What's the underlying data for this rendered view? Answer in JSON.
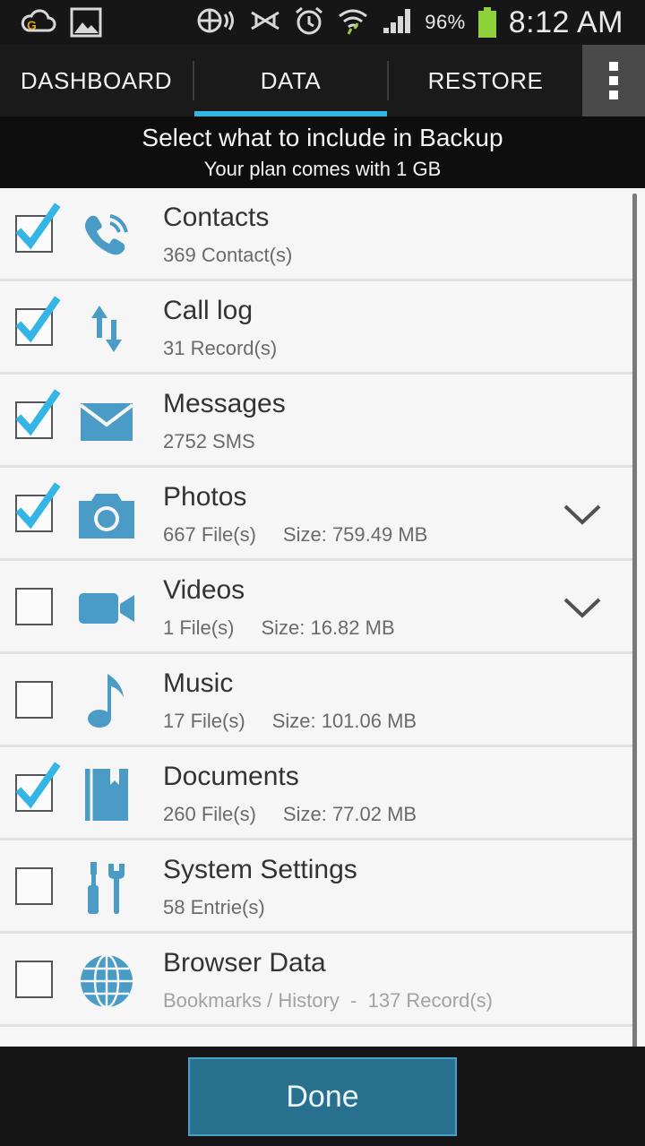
{
  "status_bar": {
    "battery_percent": "96%",
    "time": "8:12 AM",
    "icons": [
      "cloud-icon",
      "image-icon",
      "nfc-icon",
      "vibrate-icon",
      "alarm-icon",
      "wifi-icon",
      "signal-icon",
      "battery-icon"
    ]
  },
  "tabs": [
    {
      "label": "DASHBOARD",
      "selected": false
    },
    {
      "label": "DATA",
      "selected": true
    },
    {
      "label": "RESTORE",
      "selected": false
    }
  ],
  "header": {
    "title": "Select what to include in Backup",
    "subtitle": "Your plan comes with 1 GB"
  },
  "items": [
    {
      "title": "Contacts",
      "count": "369 Contact(s)",
      "size": "",
      "checked": true,
      "icon": "phone-icon",
      "expandable": false
    },
    {
      "title": "Call log",
      "count": "31 Record(s)",
      "size": "",
      "checked": true,
      "icon": "arrows-updown-icon",
      "expandable": false
    },
    {
      "title": "Messages",
      "count": "2752 SMS",
      "size": "",
      "checked": true,
      "icon": "envelope-icon",
      "expandable": false
    },
    {
      "title": "Photos",
      "count": "667 File(s)",
      "size": "Size: 759.49 MB",
      "checked": true,
      "icon": "camera-icon",
      "expandable": true
    },
    {
      "title": "Videos",
      "count": "1 File(s)",
      "size": "Size: 16.82 MB",
      "checked": false,
      "icon": "video-camera-icon",
      "expandable": true
    },
    {
      "title": "Music",
      "count": "17 File(s)",
      "size": "Size: 101.06 MB",
      "checked": false,
      "icon": "music-note-icon",
      "expandable": false
    },
    {
      "title": "Documents",
      "count": "260 File(s)",
      "size": "Size: 77.02 MB",
      "checked": true,
      "icon": "book-icon",
      "expandable": false
    },
    {
      "title": "System Settings",
      "count": "58 Entrie(s)",
      "size": "",
      "checked": false,
      "icon": "tools-icon",
      "expandable": false
    },
    {
      "title": "Browser Data",
      "count": "Bookmarks / History  -  137 Record(s)",
      "size": "",
      "checked": false,
      "icon": "globe-icon",
      "expandable": false
    }
  ],
  "footer": {
    "done_label": "Done"
  },
  "colors": {
    "accent": "#33b5e5",
    "icon": "#4a9cc7",
    "check": "#33b5e5",
    "done_button": "#27708e"
  }
}
